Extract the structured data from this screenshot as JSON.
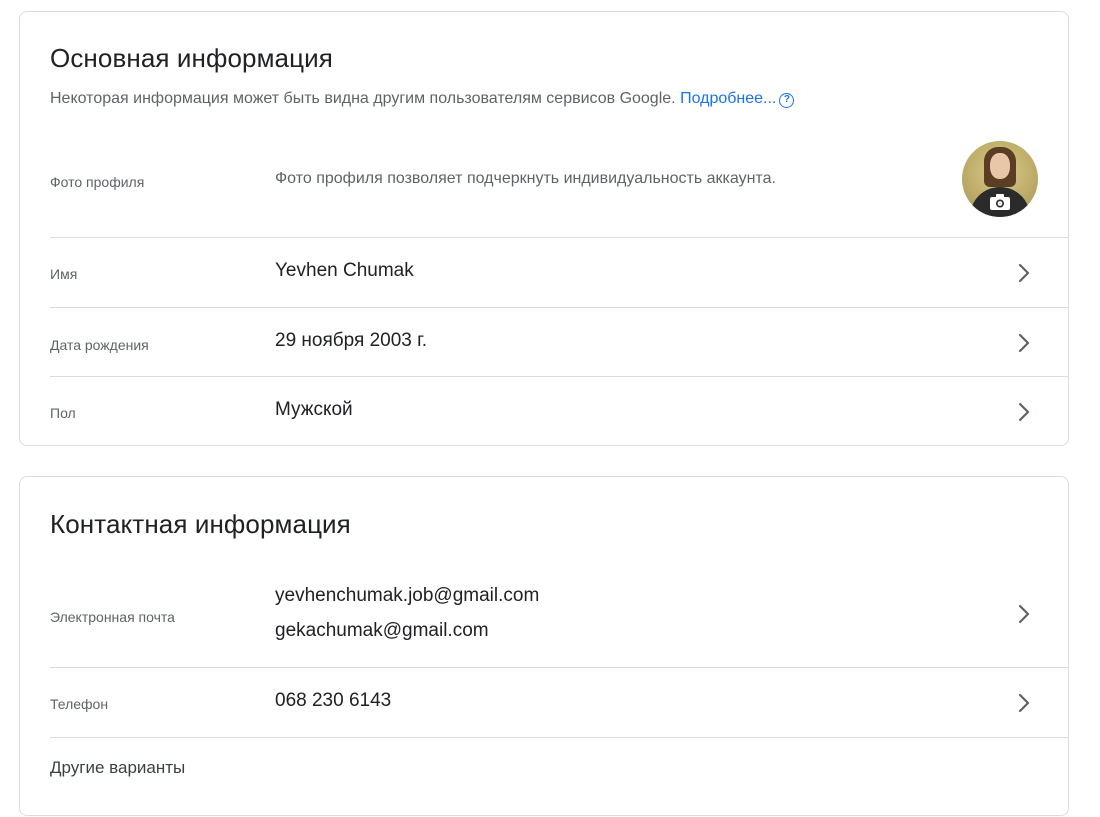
{
  "basic": {
    "title": "Основная информация",
    "subtitle": "Некоторая информация может быть видна другим пользователям сервисов Google.",
    "learn_more": "Подробнее...",
    "help_icon_glyph": "?",
    "photo": {
      "label": "Фото профиля",
      "description": "Фото профиля позволяет подчеркнуть индивидуальность аккаунта."
    },
    "rows": [
      {
        "label": "Имя",
        "value": "Yevhen Chumak"
      },
      {
        "label": "Дата рождения",
        "value": "29 ноября 2003 г."
      },
      {
        "label": "Пол",
        "value": "Мужской"
      }
    ]
  },
  "contact": {
    "title": "Контактная информация",
    "email": {
      "label": "Электронная почта",
      "values": [
        "yevhenchumak.job@gmail.com",
        "gekachumak@gmail.com"
      ]
    },
    "phone": {
      "label": "Телефон",
      "value": "068 230 6143"
    },
    "other": {
      "label": "Другие варианты"
    }
  },
  "colors": {
    "link": "#1a73e8",
    "divider": "#dadce0",
    "secondary_text": "#5f6368",
    "primary_text": "#202124"
  },
  "icons": [
    "help-circle-icon",
    "camera-icon",
    "chevron-right-icon"
  ]
}
